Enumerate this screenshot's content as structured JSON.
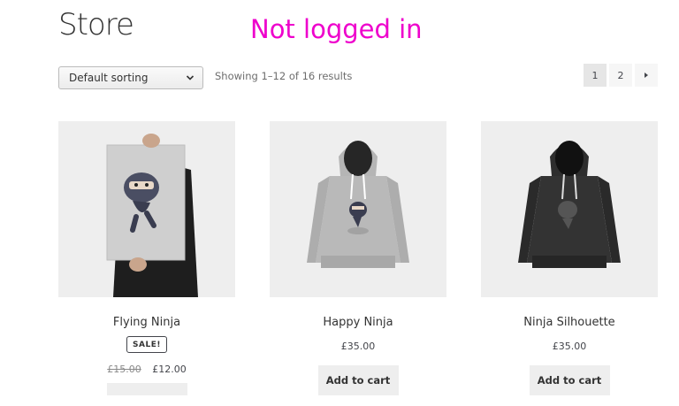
{
  "page": {
    "title": "Store",
    "login_status": "Not logged in"
  },
  "toolbar": {
    "sorting_selected": "Default sorting",
    "result_count": "Showing 1–12 of 16 results"
  },
  "pagination": {
    "pages": [
      "1",
      "2"
    ],
    "current": "1",
    "next_icon": "triangle-right-icon"
  },
  "products": [
    {
      "title": "Flying Ninja",
      "badge": "SALE!",
      "old_price": "£15.00",
      "price": "£12.00",
      "image": "ninja-poster-image"
    },
    {
      "title": "Happy Ninja",
      "price": "£35.00",
      "button": "Add to cart",
      "image": "grey-hoodie-image"
    },
    {
      "title": "Ninja Silhouette",
      "price": "£35.00",
      "button": "Add to cart",
      "image": "black-hoodie-image"
    }
  ],
  "colors": {
    "login_status": "#ee00cc",
    "thumb_bg": "#eeeeee",
    "button_bg": "#eeeeee"
  }
}
